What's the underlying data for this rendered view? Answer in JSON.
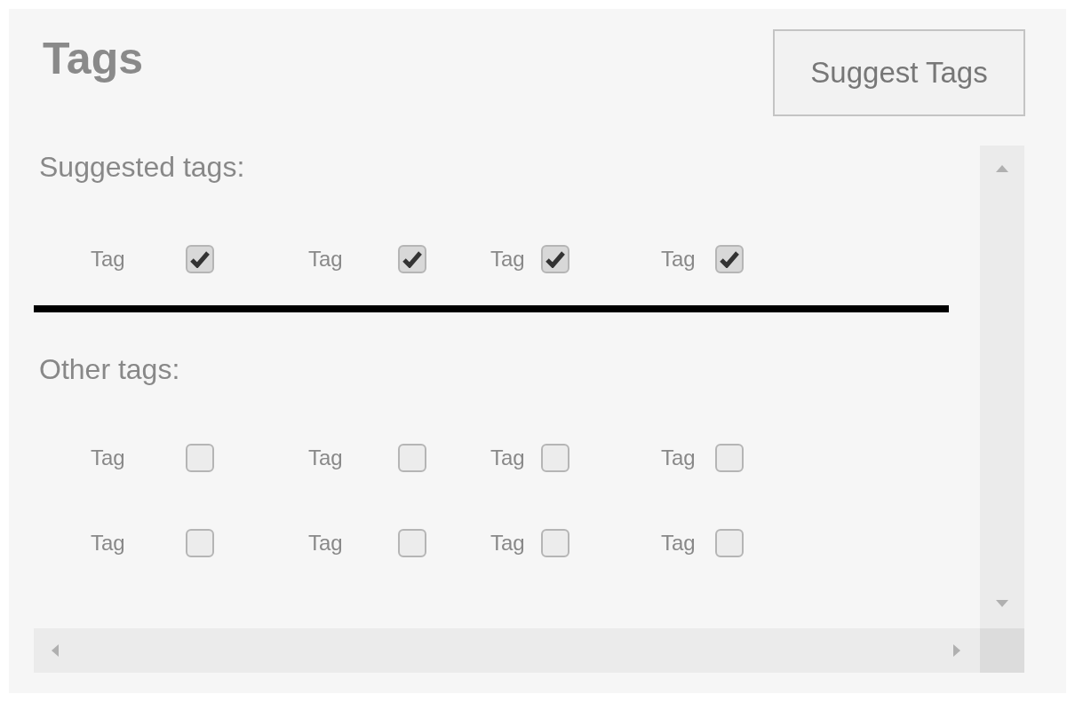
{
  "title": "Tags",
  "suggest_button": "Suggest Tags",
  "sections": [
    {
      "heading": "Suggested tags:",
      "rows": [
        [
          {
            "label": "Tag",
            "checked": true
          },
          {
            "label": "Tag",
            "checked": true
          },
          {
            "label": "Tag",
            "checked": true
          },
          {
            "label": "Tag",
            "checked": true
          }
        ]
      ]
    },
    {
      "heading": "Other tags:",
      "rows": [
        [
          {
            "label": "Tag",
            "checked": false
          },
          {
            "label": "Tag",
            "checked": false
          },
          {
            "label": "Tag",
            "checked": false
          },
          {
            "label": "Tag",
            "checked": false
          }
        ],
        [
          {
            "label": "Tag",
            "checked": false
          },
          {
            "label": "Tag",
            "checked": false
          },
          {
            "label": "Tag",
            "checked": false
          },
          {
            "label": "Tag",
            "checked": false
          }
        ]
      ]
    }
  ]
}
